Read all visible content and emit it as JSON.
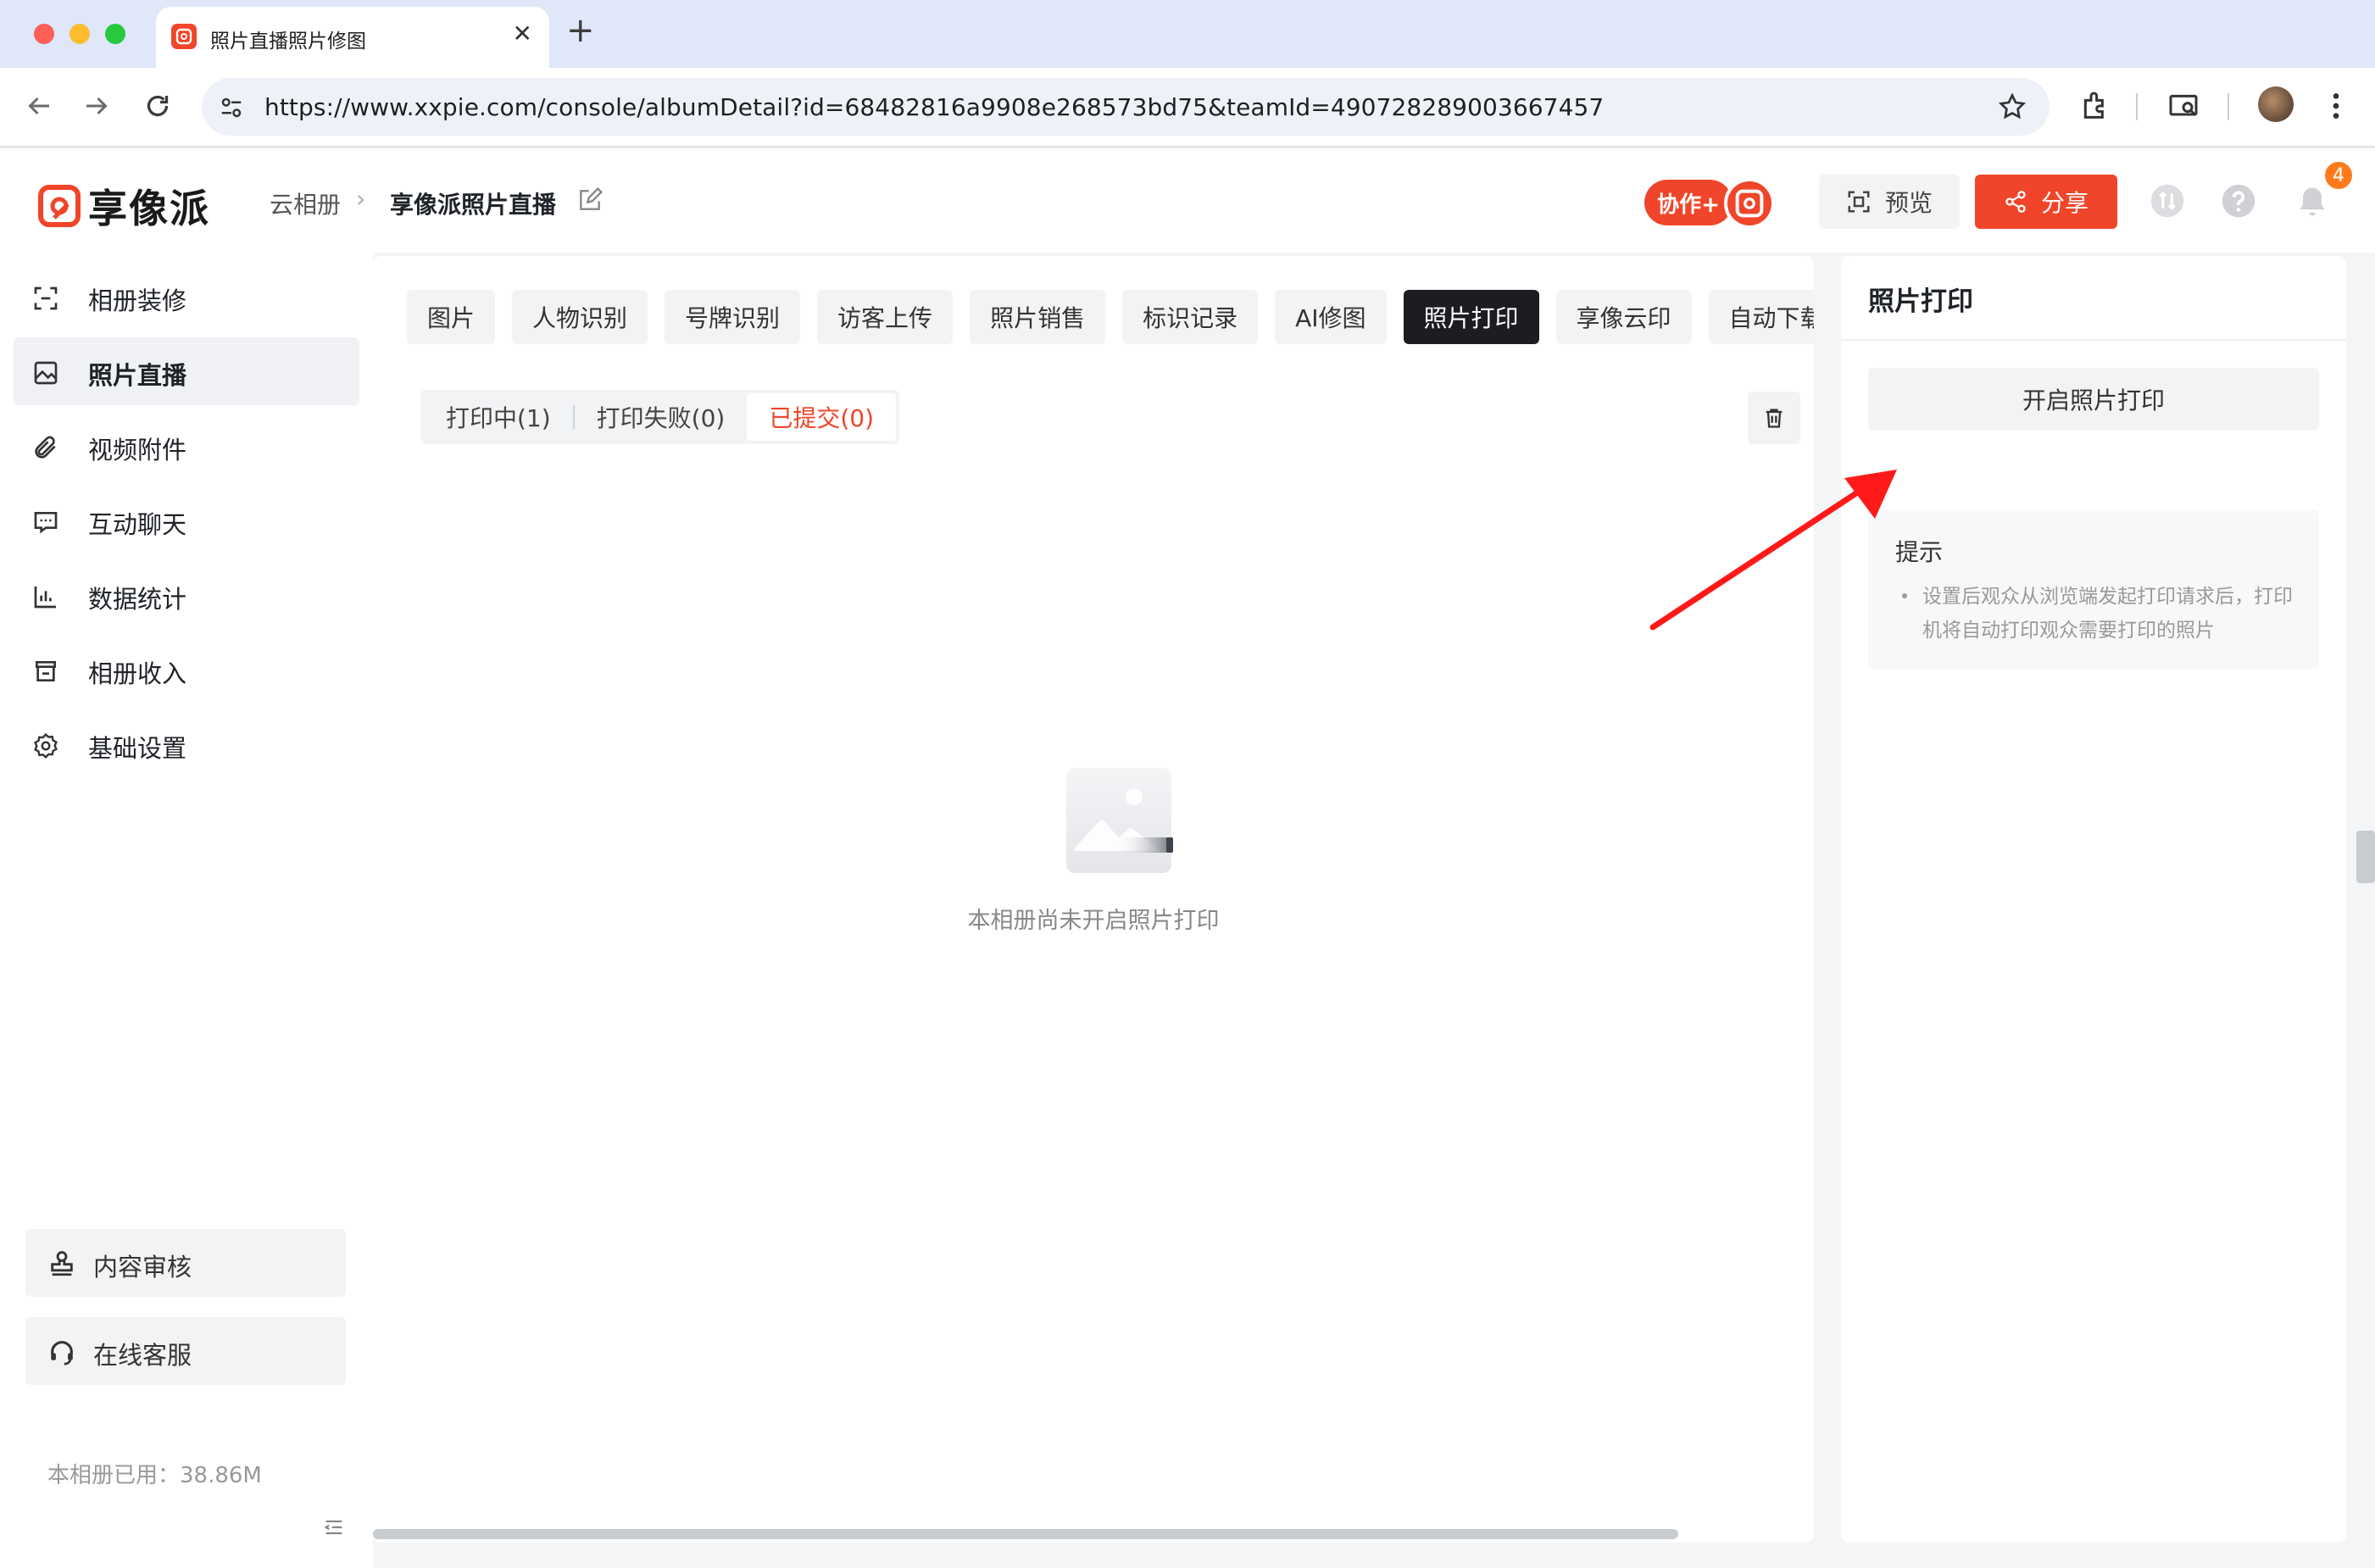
{
  "browser": {
    "tab_title": "照片直播照片修图",
    "url": "https://www.xxpie.com/console/albumDetail?id=68482816a9908e268573bd75&teamId=490728289003667457"
  },
  "header": {
    "logo_text": "享像派",
    "breadcrumb_root": "云相册",
    "breadcrumb_current": "享像派照片直播",
    "collab_label": "协作+",
    "preview_label": "预览",
    "share_label": "分享",
    "notification_count": "4"
  },
  "sidebar": {
    "items": [
      {
        "label": "相册装修",
        "icon": "frame-icon"
      },
      {
        "label": "照片直播",
        "icon": "image-icon"
      },
      {
        "label": "视频附件",
        "icon": "paperclip-icon"
      },
      {
        "label": "互动聊天",
        "icon": "chat-icon"
      },
      {
        "label": "数据统计",
        "icon": "chart-icon"
      },
      {
        "label": "相册收入",
        "icon": "store-icon"
      },
      {
        "label": "基础设置",
        "icon": "gear-icon"
      }
    ],
    "content_review": "内容审核",
    "online_service": "在线客服",
    "usage": "本相册已用：38.86M"
  },
  "main": {
    "tabs": [
      "图片",
      "人物识别",
      "号牌识别",
      "访客上传",
      "照片销售",
      "标识记录",
      "AI修图",
      "照片打印",
      "享像云印",
      "自动下载"
    ],
    "active_tab": "照片打印",
    "segments": [
      "打印中(1)",
      "打印失败(0)",
      "已提交(0)"
    ],
    "empty_text": "本相册尚未开启照片打印"
  },
  "right_panel": {
    "title": "照片打印",
    "enable_button": "开启照片打印",
    "tip_title": "提示",
    "tip_text": "设置后观众从浏览端发起打印请求后，打印机将自动打印观众需要打印的照片"
  },
  "colors": {
    "accent": "#f0452a",
    "dark_tab": "#1b1d22",
    "annotation_arrow": "#ff1a1a"
  }
}
